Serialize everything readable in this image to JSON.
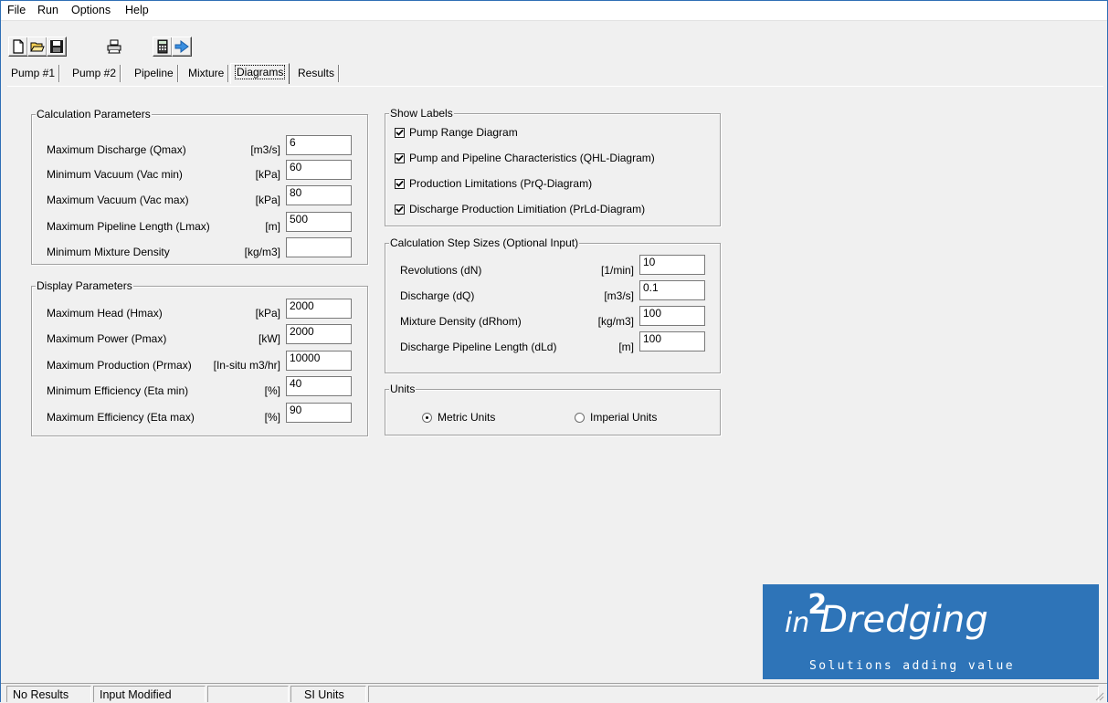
{
  "menu": {
    "items": [
      "File",
      "Run",
      "Options",
      "Help"
    ]
  },
  "toolbar": {
    "icons": [
      "new-file-icon",
      "open-folder-icon",
      "save-icon",
      "print-icon",
      "calculator-icon",
      "run-arrow-icon"
    ]
  },
  "tabs": [
    {
      "label": "Pump #1",
      "active": false
    },
    {
      "label": "Pump #2",
      "active": false
    },
    {
      "label": "Pipeline",
      "active": false
    },
    {
      "label": "Mixture",
      "active": false
    },
    {
      "label": "Diagrams",
      "active": true
    },
    {
      "label": "Results",
      "active": false
    }
  ],
  "calc_params": {
    "title": "Calculation Parameters",
    "rows": [
      {
        "label": "Maximum Discharge (Qmax)",
        "unit": "[m3/s]",
        "value": "6"
      },
      {
        "label": "Minimum Vacuum (Vac min)",
        "unit": "[kPa]",
        "value": "60"
      },
      {
        "label": "Maximum Vacuum (Vac max)",
        "unit": "[kPa]",
        "value": "80"
      },
      {
        "label": "Maximum Pipeline Length (Lmax)",
        "unit": "[m]",
        "value": "500"
      },
      {
        "label": "Minimum Mixture Density",
        "unit": "[kg/m3]",
        "value": ""
      }
    ]
  },
  "display_params": {
    "title": "Display Parameters",
    "rows": [
      {
        "label": "Maximum Head (Hmax)",
        "unit": "[kPa]",
        "value": "2000"
      },
      {
        "label": "Maximum Power (Pmax)",
        "unit": "[kW]",
        "value": "2000"
      },
      {
        "label": "Maximum Production (Prmax)",
        "unit": "[In-situ m3/hr]",
        "value": "10000"
      },
      {
        "label": "Minimum Efficiency (Eta min)",
        "unit": "[%]",
        "value": "40"
      },
      {
        "label": "Maximum Efficiency (Eta max)",
        "unit": "[%]",
        "value": "90"
      }
    ]
  },
  "show_labels": {
    "title": "Show Labels",
    "items": [
      {
        "label": "Pump Range Diagram",
        "checked": true
      },
      {
        "label": "Pump and Pipeline Characteristics (QHL-Diagram)",
        "checked": true
      },
      {
        "label": "Production Limitations (PrQ-Diagram)",
        "checked": true
      },
      {
        "label": "Discharge Production Limitiation (PrLd-Diagram)",
        "checked": true
      }
    ]
  },
  "step_sizes": {
    "title": "Calculation Step Sizes (Optional Input)",
    "rows": [
      {
        "label": "Revolutions (dN)",
        "unit": "[1/min]",
        "value": "10"
      },
      {
        "label": "Discharge (dQ)",
        "unit": "[m3/s]",
        "value": "0.1"
      },
      {
        "label": "Mixture Density (dRhom)",
        "unit": "[kg/m3]",
        "value": "100"
      },
      {
        "label": "Discharge Pipeline Length (dLd)",
        "unit": "[m]",
        "value": "100"
      }
    ]
  },
  "units": {
    "title": "Units",
    "options": [
      {
        "label": "Metric Units",
        "selected": true
      },
      {
        "label": "Imperial Units",
        "selected": false
      }
    ]
  },
  "logo": {
    "text_prefix": "in",
    "text_sup": "2",
    "text_main": "Dredging",
    "tagline": "Solutions adding value",
    "color": "#2e74b8"
  },
  "statusbar": {
    "panels": [
      "No Results",
      "Input Modified",
      "",
      "SI Units",
      ""
    ]
  }
}
